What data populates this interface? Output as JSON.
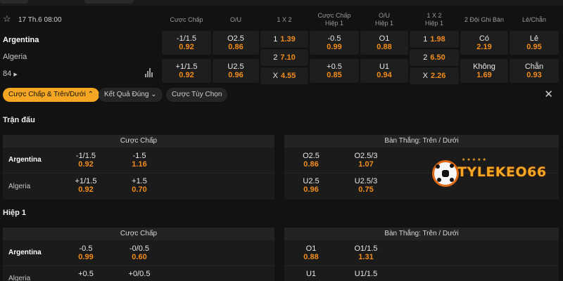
{
  "match": {
    "date": "17 Th.6 08:00",
    "home": "Argentina",
    "away": "Algeria",
    "more_markets": "84"
  },
  "headers": {
    "handicap": "Cược Chấp",
    "ou": "O/U",
    "x12": "1 X 2",
    "handicap_h1_a": "Cược Chấp",
    "handicap_h1_b": "Hiệp 1",
    "ou_h1_a": "O/U",
    "ou_h1_b": "Hiệp 1",
    "x12_h1_a": "1 X 2",
    "x12_h1_b": "Hiệp 1",
    "both_score": "2 Đội Ghi Bàn",
    "odd_even": "Lẻ/Chẵn"
  },
  "odds": {
    "handicap": [
      {
        "line": "-1/1.5",
        "price": "0.92"
      },
      {
        "line": "+1/1.5",
        "price": "0.92"
      }
    ],
    "ou": [
      {
        "line": "O2.5",
        "price": "0.86"
      },
      {
        "line": "U2.5",
        "price": "0.96"
      }
    ],
    "x12": [
      {
        "k": "1",
        "v": "1.39"
      },
      {
        "k": "2",
        "v": "7.10"
      },
      {
        "k": "X",
        "v": "4.55"
      }
    ],
    "handicap_h1": [
      {
        "line": "-0.5",
        "price": "0.99"
      },
      {
        "line": "+0.5",
        "price": "0.85"
      }
    ],
    "ou_h1": [
      {
        "line": "O1",
        "price": "0.88"
      },
      {
        "line": "U1",
        "price": "0.94"
      }
    ],
    "x12_h1": [
      {
        "k": "1",
        "v": "1.98"
      },
      {
        "k": "2",
        "v": "6.50"
      },
      {
        "k": "X",
        "v": "2.26"
      }
    ],
    "both_score": [
      {
        "line": "Có",
        "price": "2.19"
      },
      {
        "line": "Không",
        "price": "1.69"
      }
    ],
    "odd_even": [
      {
        "line": "Lẻ",
        "price": "0.95"
      },
      {
        "line": "Chẵn",
        "price": "0.93"
      }
    ]
  },
  "tabs": [
    {
      "label": "Cược Chấp & Trên/Dưới"
    },
    {
      "label": "Kết Quả Đúng"
    },
    {
      "label": "Cược Tùy Chọn"
    }
  ],
  "sections": [
    {
      "title": "Trận đấu",
      "left_head": "Cược Chấp",
      "right_head": "Bàn Thắng: Trên / Dưới",
      "rows": [
        {
          "team": "Argentina",
          "l": [
            {
              "a": "-1/1.5",
              "b": "0.92"
            },
            {
              "a": "-1.5",
              "b": "1.16"
            }
          ],
          "r": [
            {
              "a": "O2.5",
              "b": "0.86"
            },
            {
              "a": "O2.5/3",
              "b": "1.07"
            }
          ]
        },
        {
          "team": "Algeria",
          "l": [
            {
              "a": "+1/1.5",
              "b": "0.92"
            },
            {
              "a": "+1.5",
              "b": "0.70"
            }
          ],
          "r": [
            {
              "a": "U2.5",
              "b": "0.96"
            },
            {
              "a": "U2.5/3",
              "b": "0.75"
            }
          ]
        }
      ]
    },
    {
      "title": "Hiệp 1",
      "left_head": "Cược Chấp",
      "right_head": "Bàn Thắng: Trên / Dưới",
      "rows": [
        {
          "team": "Argentina",
          "l": [
            {
              "a": "-0.5",
              "b": "0.99"
            },
            {
              "a": "-0/0.5",
              "b": "0.60"
            }
          ],
          "r": [
            {
              "a": "O1",
              "b": "0.88"
            },
            {
              "a": "O1/1.5",
              "b": "1.31"
            }
          ]
        },
        {
          "team": "Algeria",
          "l": [
            {
              "a": "+0.5",
              "b": ""
            },
            {
              "a": "+0/0.5",
              "b": ""
            }
          ],
          "r": [
            {
              "a": "U1",
              "b": ""
            },
            {
              "a": "U1/1.5",
              "b": ""
            }
          ]
        }
      ]
    }
  ],
  "watermark": {
    "text": "TYLEKEO66"
  },
  "colors": {
    "accent": "#f5a623",
    "odds": "#f28c1a",
    "background": "#121212"
  }
}
